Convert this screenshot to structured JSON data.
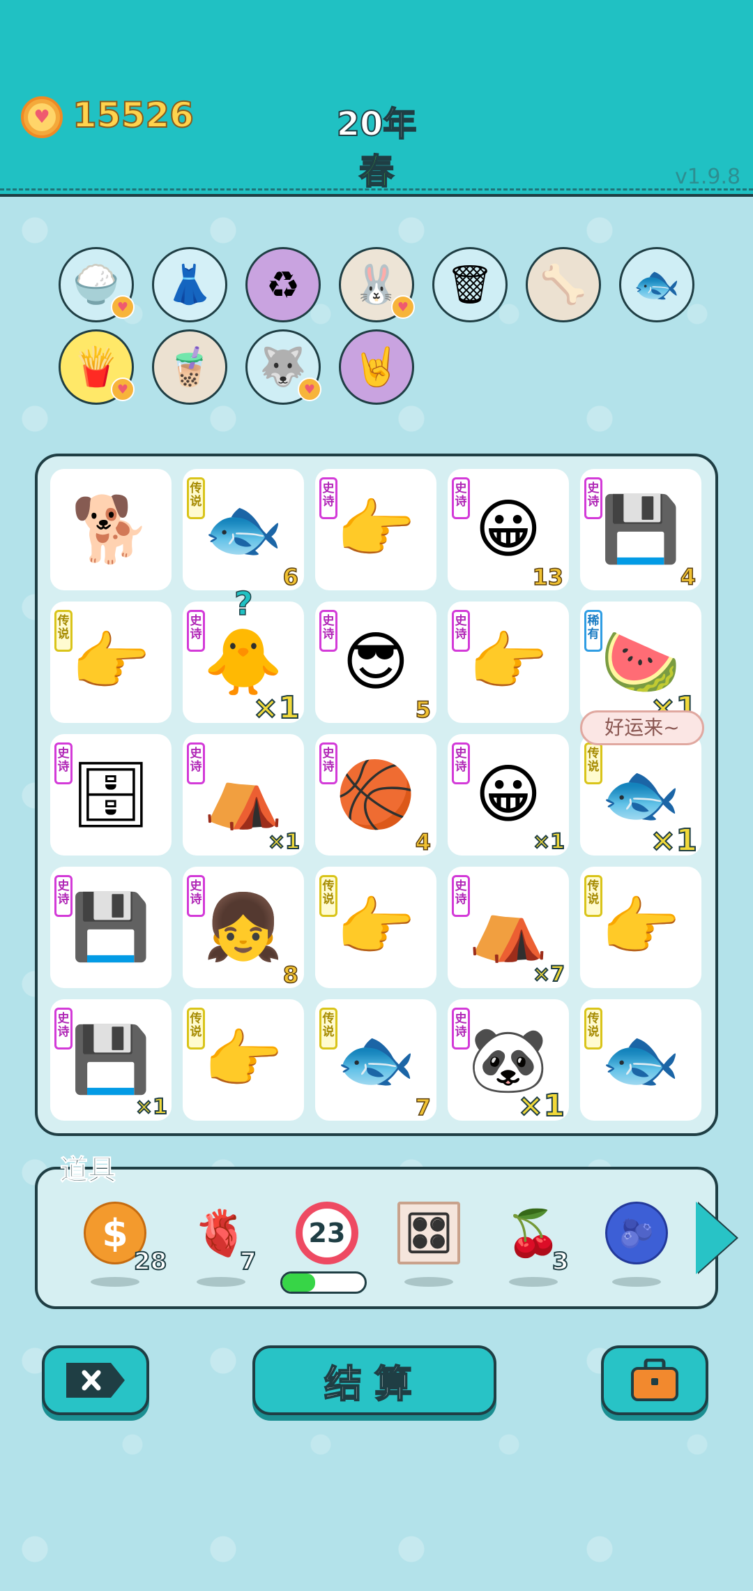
{
  "header": {
    "coins": "15526",
    "year": "20年",
    "season": "春",
    "version": "v1.9.8"
  },
  "buffs": [
    {
      "icon": "rice-bowl-icon",
      "glyph": "🍚",
      "bg": "#cfeef5",
      "heart": true
    },
    {
      "icon": "skirt-icon",
      "glyph": "👗",
      "bg": "#d4f0f7",
      "heart": false
    },
    {
      "icon": "recycle-icon",
      "glyph": "♻",
      "bg": "#c9a3e0",
      "heart": false
    },
    {
      "icon": "rabbit-icon",
      "glyph": "🐰",
      "bg": "#ede4d6",
      "heart": true
    },
    {
      "icon": "trash-bag-icon",
      "glyph": "🗑",
      "bg": "#cfeef5",
      "heart": false
    },
    {
      "icon": "pet-food-icon",
      "glyph": "🦴",
      "bg": "#ece1d1",
      "heart": false
    },
    {
      "icon": "fish-tank-icon",
      "glyph": "🐟",
      "bg": "#cfeef5",
      "heart": false
    },
    {
      "icon": "fries-icon",
      "glyph": "🍟",
      "bg": "#ffe868",
      "heart": true
    },
    {
      "icon": "bubble-tea-icon",
      "glyph": "🧋",
      "bg": "#ece1d1",
      "heart": false
    },
    {
      "icon": "husky-icon",
      "glyph": "🐺",
      "bg": "#cfeef5",
      "heart": true
    },
    {
      "icon": "rock-hand-icon",
      "glyph": "🤘",
      "bg": "#c9a3e0",
      "heart": false
    }
  ],
  "grid": [
    {
      "name": "husky-dog",
      "glyph": "🐕",
      "tag": "",
      "tag_class": "",
      "count": "",
      "mult": ""
    },
    {
      "name": "koi-fish",
      "glyph": "🐟",
      "tag": "传说",
      "tag_class": "legend",
      "count": "6",
      "mult": ""
    },
    {
      "name": "grey-finger",
      "glyph": "👉",
      "tag": "史诗",
      "tag_class": "epic",
      "count": "",
      "mult": ""
    },
    {
      "name": "yellow-face",
      "glyph": "😀",
      "tag": "史诗",
      "tag_class": "epic",
      "count": "13",
      "mult": ""
    },
    {
      "name": "graphics-card",
      "glyph": "💾",
      "tag": "史诗",
      "tag_class": "epic",
      "count": "4",
      "mult": ""
    },
    {
      "name": "gold-finger",
      "glyph": "👉",
      "tag": "传说",
      "tag_class": "legend",
      "count": "",
      "mult": ""
    },
    {
      "name": "chick-wig",
      "glyph": "🐥",
      "tag": "史诗",
      "tag_class": "epic",
      "count": "",
      "mult": "×1"
    },
    {
      "name": "sunglasses-guy",
      "glyph": "😎",
      "tag": "史诗",
      "tag_class": "epic",
      "count": "5",
      "mult": ""
    },
    {
      "name": "grey-finger-2",
      "glyph": "👉",
      "tag": "史诗",
      "tag_class": "epic",
      "count": "",
      "mult": ""
    },
    {
      "name": "watermelon",
      "glyph": "🍉",
      "tag": "稀有",
      "tag_class": "rare",
      "count": "",
      "mult": "×1"
    },
    {
      "name": "server-rack",
      "glyph": "🗄",
      "tag": "史诗",
      "tag_class": "epic",
      "count": "",
      "mult": ""
    },
    {
      "name": "rabbit-tent",
      "glyph": "⛺",
      "tag": "史诗",
      "tag_class": "epic",
      "count": "",
      "mult_small": "×1"
    },
    {
      "name": "basketball-card",
      "glyph": "🏀",
      "tag": "史诗",
      "tag_class": "epic",
      "count": "4",
      "mult": ""
    },
    {
      "name": "yellow-face-2",
      "glyph": "😀",
      "tag": "史诗",
      "tag_class": "epic",
      "count": "",
      "mult_small": "×1"
    },
    {
      "name": "koi-fish-2",
      "glyph": "🐟",
      "tag": "传说",
      "tag_class": "legend",
      "count": "",
      "mult": "×1"
    },
    {
      "name": "graphics-card-2",
      "glyph": "💾",
      "tag": "史诗",
      "tag_class": "epic",
      "count": "",
      "mult": ""
    },
    {
      "name": "braided-girl",
      "glyph": "👧",
      "tag": "史诗",
      "tag_class": "epic",
      "count": "8",
      "mult": ""
    },
    {
      "name": "gold-finger-2",
      "glyph": "👉",
      "tag": "传说",
      "tag_class": "legend",
      "count": "",
      "mult": ""
    },
    {
      "name": "rabbit-tent-2",
      "glyph": "⛺",
      "tag": "史诗",
      "tag_class": "epic",
      "count": "",
      "mult_small": "×7"
    },
    {
      "name": "gold-finger-3",
      "glyph": "👉",
      "tag": "传说",
      "tag_class": "legend",
      "count": "",
      "mult": ""
    },
    {
      "name": "graphics-card-3",
      "glyph": "💾",
      "tag": "史诗",
      "tag_class": "epic",
      "count": "",
      "mult_small": "×1"
    },
    {
      "name": "gold-finger-4",
      "glyph": "👉",
      "tag": "传说",
      "tag_class": "legend",
      "count": "",
      "mult": ""
    },
    {
      "name": "koi-fish-3",
      "glyph": "🐟",
      "tag": "传说",
      "tag_class": "legend",
      "count": "7",
      "mult": ""
    },
    {
      "name": "panda",
      "glyph": "🐼",
      "tag": "史诗",
      "tag_class": "epic",
      "count": "",
      "mult": "×1"
    },
    {
      "name": "koi-fish-4",
      "glyph": "🐟",
      "tag": "传说",
      "tag_class": "legend",
      "count": "",
      "mult": ""
    }
  ],
  "bubble": "好运来~",
  "question_mark": "?",
  "items": {
    "title": "道具",
    "list": [
      {
        "icon": "coin-dollar-icon",
        "glyph": "$",
        "count": "28"
      },
      {
        "icon": "liver-icon",
        "glyph": "🫀",
        "count": "7"
      },
      {
        "icon": "ball-23-icon",
        "glyph": "23",
        "count": "",
        "progress": 0.4
      },
      {
        "icon": "remote-card-icon",
        "glyph": "🎛",
        "count": ""
      },
      {
        "icon": "lychee-icon",
        "glyph": "🍒",
        "count": "3"
      },
      {
        "icon": "blueberry-icon",
        "glyph": "🫐",
        "count": ""
      }
    ]
  },
  "buttons": {
    "settle_label": "结算"
  }
}
